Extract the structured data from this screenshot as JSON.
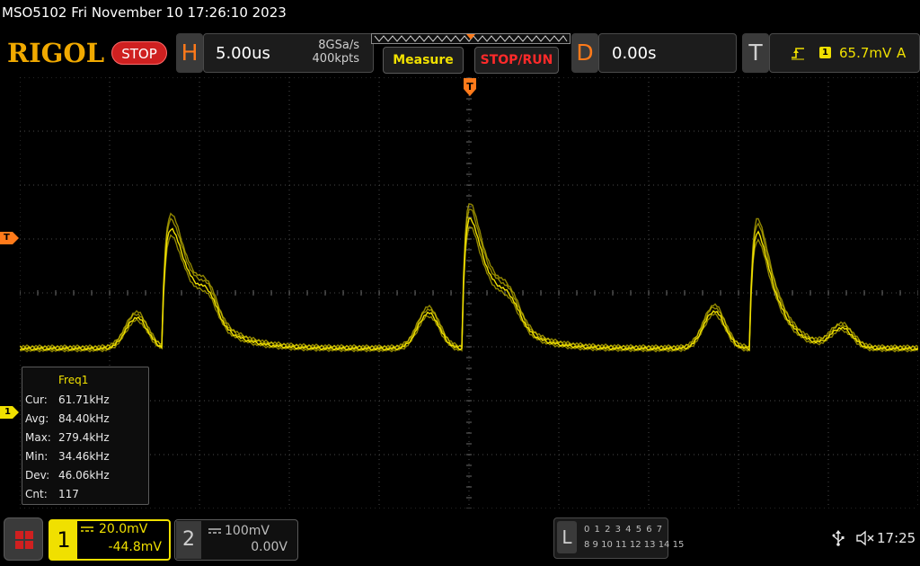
{
  "status_line": "MSO5102  Fri November 10 17:26:10 2023",
  "brand": {
    "logo": "RIGOL",
    "run_state": "STOP"
  },
  "horizontal": {
    "letter": "H",
    "timebase": "5.00us",
    "sample_rate": "8GSa/s",
    "memory_depth": "400kpts"
  },
  "buttons": {
    "measure": "Measure",
    "stop_run": "STOP/RUN"
  },
  "delay": {
    "letter": "D",
    "value": "0.00s"
  },
  "trigger": {
    "letter": "T",
    "source": "1",
    "level": "65.7mV",
    "mode": "A"
  },
  "markers": {
    "trigger_level": "T",
    "channel1": "1"
  },
  "measurement": {
    "title": "Freq1",
    "rows": [
      {
        "label": "Cur:",
        "value": "61.71kHz"
      },
      {
        "label": "Avg:",
        "value": "84.40kHz"
      },
      {
        "label": "Max:",
        "value": "279.4kHz"
      },
      {
        "label": "Min:",
        "value": "34.46kHz"
      },
      {
        "label": "Dev:",
        "value": "46.06kHz"
      },
      {
        "label": "Cnt:",
        "value": "117"
      }
    ]
  },
  "channels": [
    {
      "number": "1",
      "scale": "20.0mV",
      "offset": "-44.8mV",
      "color": "#f0e000"
    },
    {
      "number": "2",
      "scale": "100mV",
      "offset": "0.00V",
      "color": "#bdbdbd"
    }
  ],
  "logic": {
    "letter": "L",
    "row1": "0 1 2 3  4 5 6 7",
    "row2": "8 9 10 11 12 13 14 15"
  },
  "system": {
    "time": "17:25"
  },
  "colors": {
    "trace": "#f0e000",
    "accent": "#ff7a1a",
    "stop": "#cf2020",
    "grid": "#5a5a5a"
  },
  "icons": {
    "usb": "usb-icon",
    "speaker": "speaker-muted-icon",
    "menu": "menu-grid-icon"
  }
}
